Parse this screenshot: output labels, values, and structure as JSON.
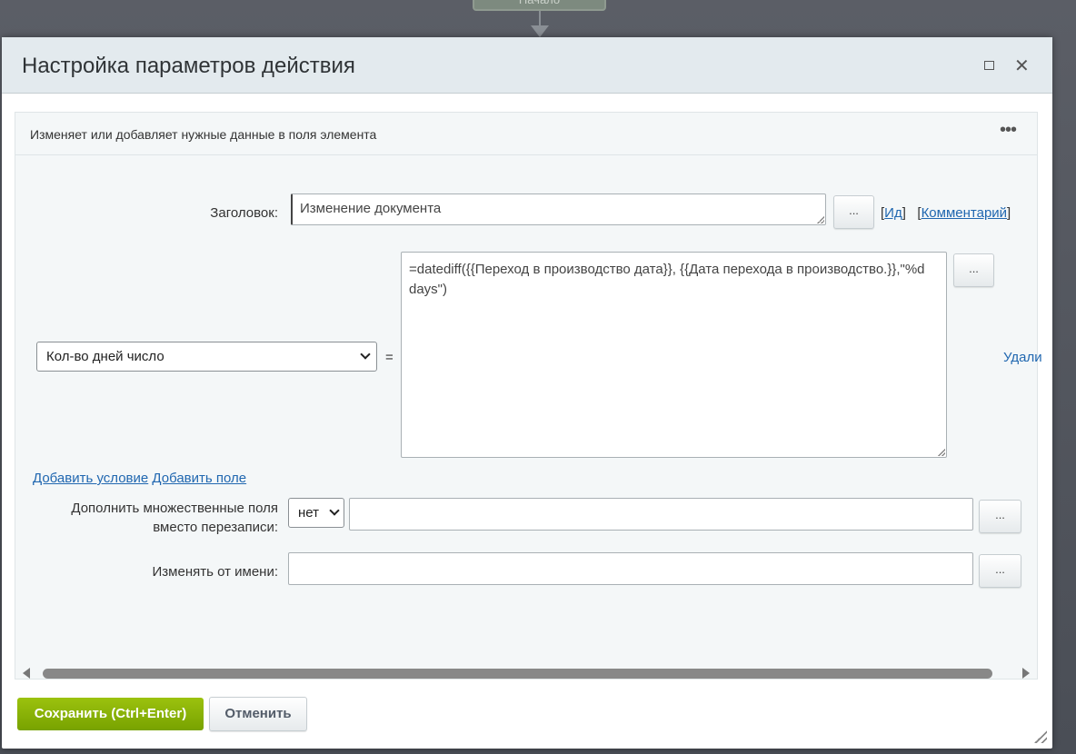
{
  "background": {
    "node_label": "Начало"
  },
  "dialog": {
    "title": "Настройка параметров действия",
    "panel": {
      "description": "Изменяет или добавляет нужные данные в поля элемента",
      "title_label": "Заголовок:",
      "title_value": "Изменение документа",
      "dots_button": "...",
      "id_link": "Ид",
      "comment_link": "Комментарий",
      "field_select": "Кол-во дней число",
      "equals": "=",
      "expression": "=datediff({{Переход в производство дата}}, {{Дата перехода в производство.}},\"%d days\")",
      "delete_link": "Удали",
      "add_condition": "Добавить условие",
      "add_field": "Добавить поле",
      "append_label": "Дополнить множественные поля вместо перезаписи:",
      "append_select": "нет",
      "append_value": "",
      "modify_as_label": "Изменять от имени:",
      "modify_as_value": ""
    },
    "save_button": "Сохранить (Ctrl+Enter)",
    "cancel_button": "Отменить"
  }
}
